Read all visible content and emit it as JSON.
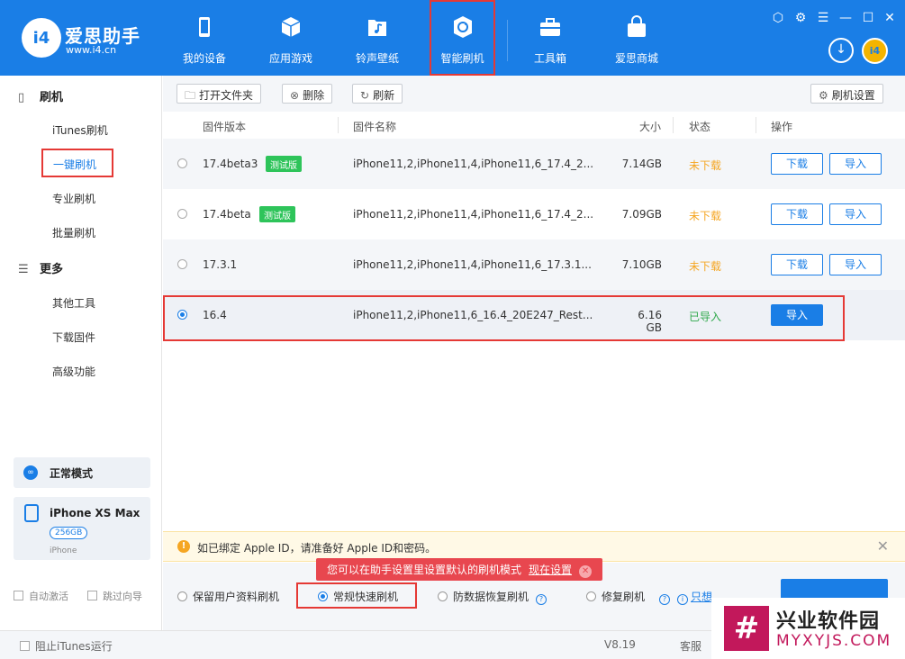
{
  "app": {
    "brand": "爱思助手",
    "url": "www.i4.cn",
    "logo_text": "i4"
  },
  "nav": [
    {
      "label": "我的设备",
      "icon": "phone-icon"
    },
    {
      "label": "应用游戏",
      "icon": "cube-icon"
    },
    {
      "label": "铃声壁纸",
      "icon": "music-folder-icon"
    },
    {
      "label": "智能刷机",
      "icon": "flash-sync-icon",
      "active": true
    },
    {
      "label": "工具箱",
      "icon": "toolbox-icon"
    },
    {
      "label": "爱思商城",
      "icon": "shopping-bag-icon"
    }
  ],
  "sidebar": {
    "section1": "刷机",
    "items1": [
      "iTunes刷机",
      "一键刷机",
      "专业刷机",
      "批量刷机"
    ],
    "selected": "一键刷机",
    "section2": "更多",
    "items2": [
      "其他工具",
      "下载固件",
      "高级功能"
    ],
    "mode": "正常模式",
    "device_name": "iPhone XS Max",
    "device_capacity": "256GB",
    "device_type": "iPhone",
    "check1": "自动激活",
    "check2": "跳过向导"
  },
  "toolbar": {
    "open_folder": "打开文件夹",
    "delete": "删除",
    "refresh": "刷新",
    "settings": "刷机设置"
  },
  "table": {
    "headers": [
      "固件版本",
      "固件名称",
      "大小",
      "状态",
      "操作"
    ],
    "rows": [
      {
        "version": "17.4beta3",
        "tag": "测试版",
        "name": "iPhone11,2,iPhone11,4,iPhone11,6_17.4_2...",
        "size": "7.14GB",
        "status": "未下载",
        "btn1": "下载",
        "btn2": "导入",
        "selected": false
      },
      {
        "version": "17.4beta",
        "tag": "测试版",
        "name": "iPhone11,2,iPhone11,4,iPhone11,6_17.4_2...",
        "size": "7.09GB",
        "status": "未下载",
        "btn1": "下载",
        "btn2": "导入",
        "selected": false
      },
      {
        "version": "17.3.1",
        "tag": "",
        "name": "iPhone11,2,iPhone11,4,iPhone11,6_17.3.1...",
        "size": "7.10GB",
        "status": "未下载",
        "btn1": "下载",
        "btn2": "导入",
        "selected": false
      },
      {
        "version": "16.4",
        "tag": "",
        "name": "iPhone11,2,iPhone11,6_16.4_20E247_Rest...",
        "size": "6.16 GB",
        "status": "已导入",
        "btn1": "导入",
        "btn2": "",
        "selected": true
      }
    ]
  },
  "notice": "如已绑定 Apple ID，请准备好 Apple ID和密码。",
  "tip": {
    "text": "您可以在助手设置里设置默认的刷机模式",
    "link": "现在设置"
  },
  "options": [
    "保留用户资料刷机",
    "常规快速刷机",
    "防数据恢复刷机",
    "修复刷机"
  ],
  "options_selected": "常规快速刷机",
  "extra_link": "只想",
  "statusbar": {
    "itunes": "阻止iTunes运行",
    "version": "V8.19",
    "service": "客服"
  },
  "watermark": {
    "cn": "兴业软件园",
    "en": "MYXYJS.COM"
  },
  "colors": {
    "primary": "#1a7ee6",
    "highlight": "#e53935",
    "status_pending": "#f5a623",
    "status_done": "#2ea84a",
    "tag_bg": "#2ec45a"
  }
}
